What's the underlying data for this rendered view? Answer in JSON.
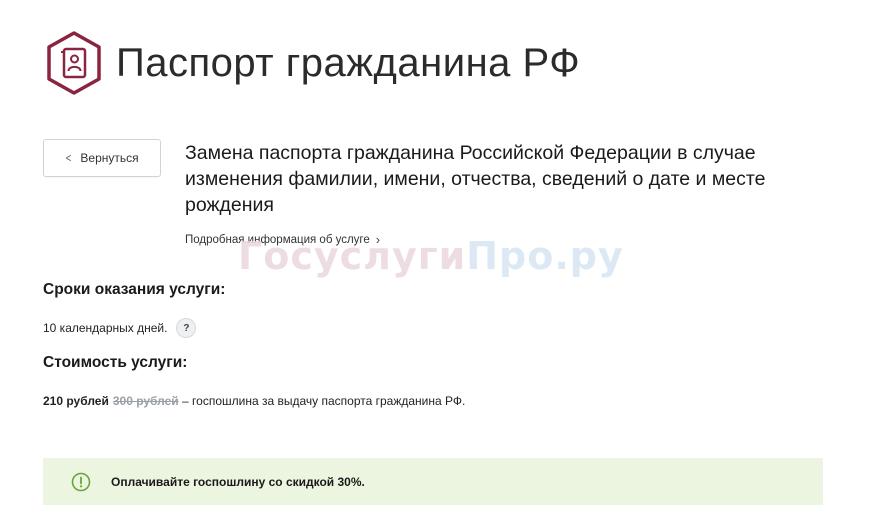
{
  "header": {
    "title": "Паспорт гражданина РФ",
    "logo_icon": "passport-icon",
    "brand_color": "#8b2440"
  },
  "navigation": {
    "back_label": "Вернуться",
    "back_icon": "chevron-left-icon"
  },
  "service": {
    "title": "Замена паспорта гражданина Российской Федерации в случае изменения фамилии, имени, отчества, сведений о дате и месте рождения",
    "more_info_label": "Подробная информация об услуге",
    "more_info_icon": "chevron-right-icon"
  },
  "watermark": {
    "part1": "Госуслуги",
    "part2": "Про.ру"
  },
  "terms": {
    "heading": "Сроки оказания услуги:",
    "value": "10 календарных дней.",
    "help_label": "?"
  },
  "cost": {
    "heading": "Стоимость услуги:",
    "price_new": "210 рублей",
    "price_old": "300 рублей",
    "description": "– госпошлина за выдачу паспорта гражданина РФ."
  },
  "discount": {
    "text": "Оплачивайте госпошлину со скидкой 30%.",
    "icon": "info-icon",
    "background_color": "#ebf5e0",
    "icon_color": "#6aa53a"
  }
}
